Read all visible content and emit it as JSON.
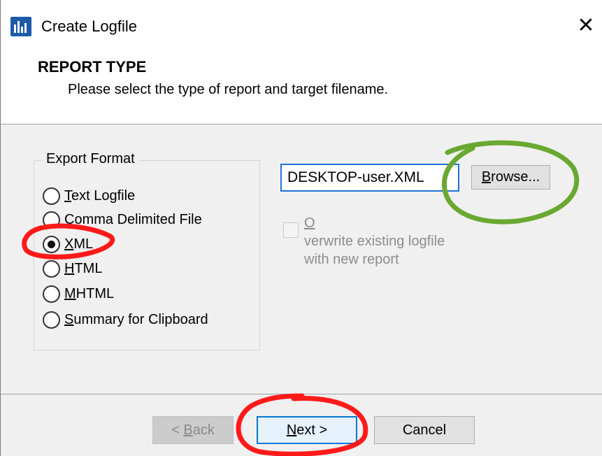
{
  "window": {
    "title": "Create Logfile",
    "close_glyph": "✕",
    "icon": "app-icon"
  },
  "header": {
    "title": "REPORT TYPE",
    "subtitle": "Please select the type of report and target filename."
  },
  "export_format": {
    "legend": "Export Format",
    "options": [
      {
        "label": "Text Logfile",
        "access_key": "T",
        "rest": "ext Logfile",
        "checked": false
      },
      {
        "label": "Comma Delimited File",
        "access_key": "C",
        "rest": "omma Delimited File",
        "checked": false
      },
      {
        "label": "XML",
        "access_key": "X",
        "rest": "ML",
        "checked": true
      },
      {
        "label": "HTML",
        "access_key": "H",
        "rest": "TML",
        "checked": false
      },
      {
        "label": "MHTML",
        "access_key": "M",
        "rest": "HTML",
        "checked": false
      },
      {
        "label": "Summary for Clipboard",
        "access_key": "S",
        "rest": "ummary for Clipboard",
        "checked": false
      }
    ]
  },
  "target": {
    "filename_value": "DESKTOP-user.XML",
    "browse_label_key": "B",
    "browse_label_rest": "rowse...",
    "overwrite_line1_key": "O",
    "overwrite_line1_rest": "verwrite existing logfile",
    "overwrite_line2": "with new report",
    "overwrite_checked": false,
    "overwrite_enabled": false
  },
  "footer": {
    "back_prefix": "< ",
    "back_key": "B",
    "back_rest": "ack",
    "next_key": "N",
    "next_rest": "ext >",
    "cancel_label": "Cancel"
  },
  "colors": {
    "annotation_red": "#ff1a1a",
    "annotation_green": "#6aa832",
    "accent_blue": "#0078d7",
    "icon_blue": "#1d5aa8"
  }
}
